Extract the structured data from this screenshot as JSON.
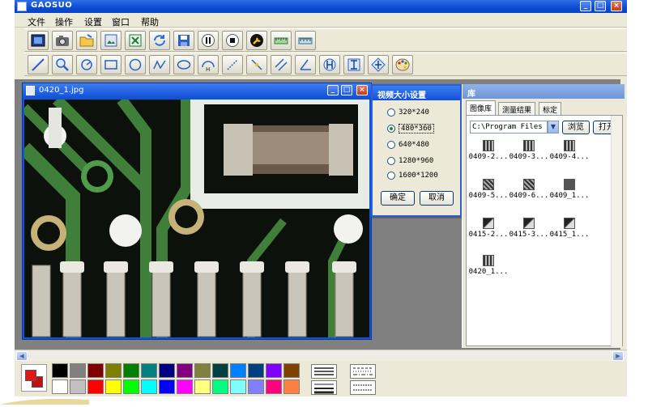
{
  "window": {
    "title": "GAOSUO"
  },
  "menu": [
    "文件",
    "操作",
    "设置",
    "窗口",
    "帮助"
  ],
  "toolbar1_icons": [
    "frame-icon",
    "camera-icon",
    "folder-open-icon",
    "image-icon",
    "excel-icon",
    "refresh-icon",
    "save-icon",
    "pause-icon",
    "stop-icon",
    "settings-wrench-icon",
    "ruler-icon",
    "scale-icon"
  ],
  "toolbar2_icons": [
    "line-tool-icon",
    "zoom-icon",
    "rotate-icon",
    "rectangle-icon",
    "circle-icon",
    "polyline-icon",
    "ellipse-icon",
    "arc-height-icon",
    "measure-line-icon",
    "point-line-icon",
    "parallel-line-icon",
    "angle-icon",
    "horizontal-distance-icon",
    "vertical-distance-icon",
    "diagonal-distance-icon",
    "palette-icon"
  ],
  "image_window": {
    "title": "0420_1.jpg"
  },
  "dialog": {
    "title": "视频大小设置",
    "options": [
      "320*240",
      "480*360",
      "640*480",
      "1280*960",
      "1600*1200"
    ],
    "selected_index": 1,
    "ok_label": "确定",
    "cancel_label": "取消"
  },
  "library": {
    "title": "库",
    "tabs": [
      "图像库",
      "测量结果",
      "标定"
    ],
    "active_tab": 0,
    "path": "C:\\Program Files",
    "browse_label": "浏览",
    "open_label": "打开",
    "thumbnails": [
      "0409-2...",
      "0409-3...",
      "0409-4...",
      "0409-5...",
      "0409-6...",
      "0409_1...",
      "0415-2...",
      "0415-3...",
      "0415_1...",
      "0420_1..."
    ]
  },
  "palette": {
    "fg_color": "#e01818",
    "bg_color": "#c01010",
    "colors_top": [
      "#000000",
      "#808080",
      "#800000",
      "#808000",
      "#008000",
      "#008080",
      "#000080",
      "#800080",
      "#808040",
      "#004040",
      "#0080ff",
      "#004080",
      "#8000ff",
      "#804000"
    ],
    "colors_bottom": [
      "#ffffff",
      "#c0c0c0",
      "#ff0000",
      "#ffff00",
      "#00ff00",
      "#00ffff",
      "#0000ff",
      "#ff00ff",
      "#ffff80",
      "#00ff80",
      "#80ffff",
      "#8080ff",
      "#ff0080",
      "#ff8040"
    ]
  }
}
